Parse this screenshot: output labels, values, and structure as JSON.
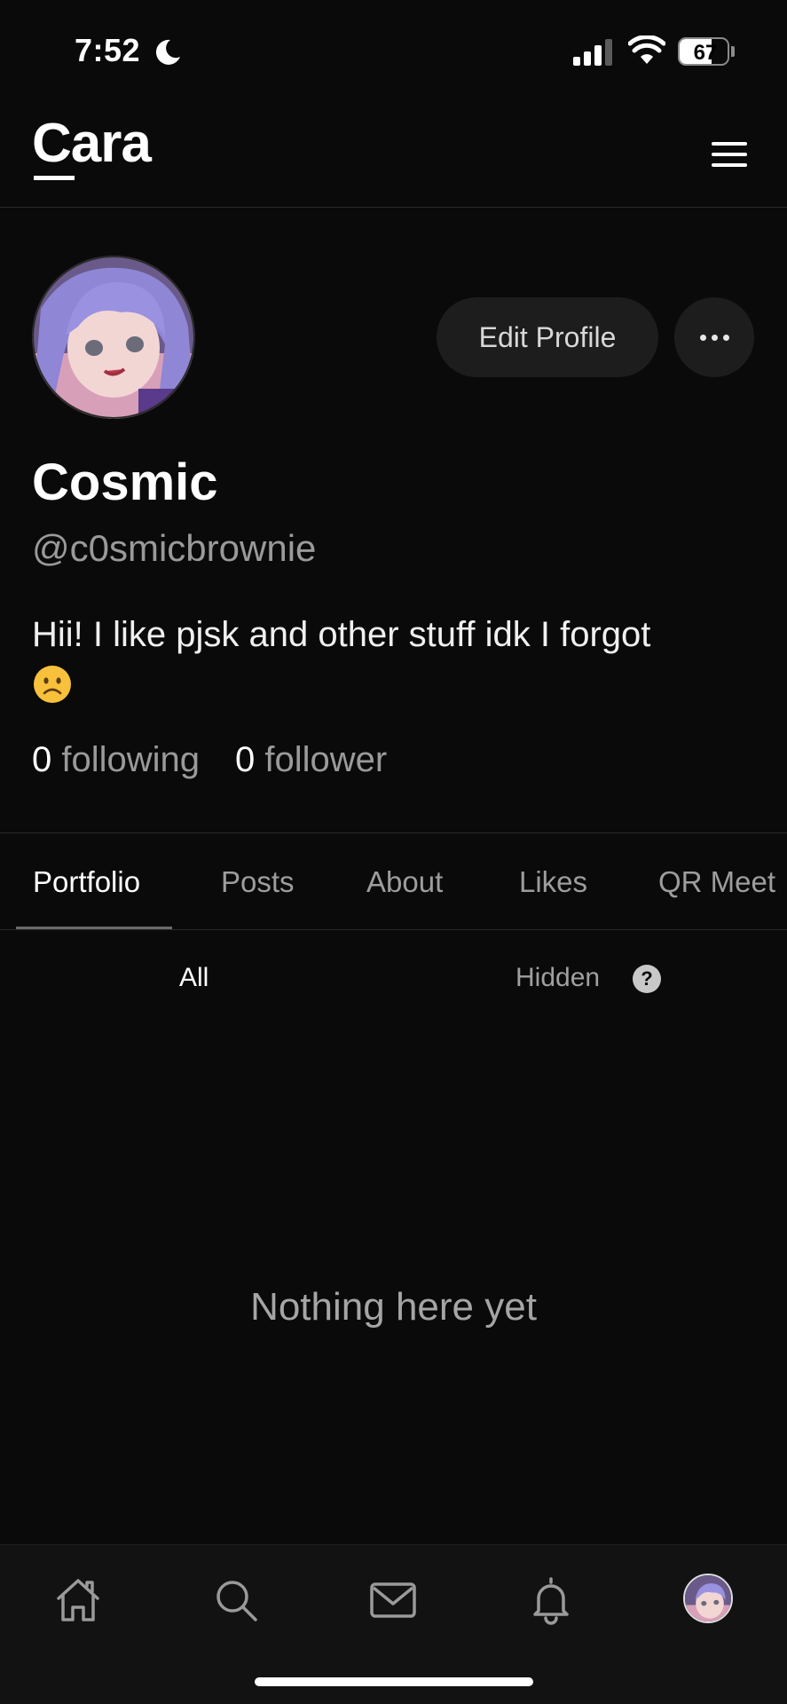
{
  "status_bar": {
    "time": "7:52",
    "battery": "67",
    "battery_level": 0.67
  },
  "app": {
    "logo": "Cara"
  },
  "profile": {
    "name": "Cosmic",
    "handle": "@c0smicbrownie",
    "bio": "Hii! I like pjsk and other stuff idk I forgot",
    "bio_emoji": "frown-emoji",
    "following_count": "0",
    "following_label": "following",
    "follower_count": "0",
    "follower_label": "follower",
    "edit_label": "Edit Profile"
  },
  "tabs": [
    {
      "label": "Portfolio",
      "active": true
    },
    {
      "label": "Posts",
      "active": false
    },
    {
      "label": "About",
      "active": false
    },
    {
      "label": "Likes",
      "active": false
    },
    {
      "label": "QR Meet",
      "active": false
    }
  ],
  "subtabs": {
    "all": "All",
    "hidden": "Hidden",
    "help_icon": "?"
  },
  "empty_state": "Nothing here yet",
  "bottom_nav": [
    "home-icon",
    "search-icon",
    "mail-icon",
    "bell-icon",
    "avatar"
  ],
  "colors": {
    "background": "#0a0a0a",
    "surface": "#1d1d1d",
    "muted_text": "#9a9a9a"
  }
}
